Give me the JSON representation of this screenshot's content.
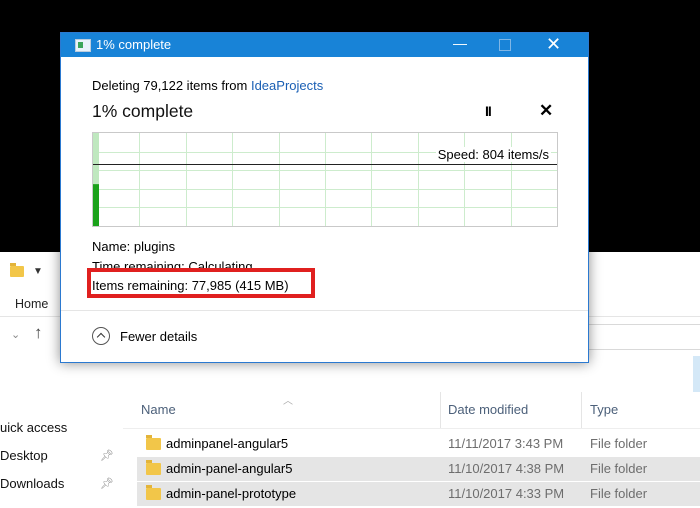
{
  "explorer": {
    "ribbon_home": "Home",
    "nav_pane": [
      {
        "label": "uick access",
        "pinned": false
      },
      {
        "label": "Desktop",
        "pinned": true
      },
      {
        "label": "Downloads",
        "pinned": true
      }
    ],
    "columns": {
      "name": "Name",
      "date": "Date modified",
      "type": "Type"
    },
    "rows": [
      {
        "name": "adminpanel-angular5",
        "date": "11/11/2017 3:43 PM",
        "type": "File folder",
        "selected": false
      },
      {
        "name": "admin-panel-angular5",
        "date": "11/10/2017 4:38 PM",
        "type": "File folder",
        "selected": true
      },
      {
        "name": "admin-panel-prototype",
        "date": "11/10/2017 4:33 PM",
        "type": "File folder",
        "selected": true
      }
    ]
  },
  "dialog": {
    "title": "1% complete",
    "deleting_prefix": "Deleting 79,122 items from ",
    "deleting_source": "IdeaProjects",
    "percent_heading": "1% complete",
    "pause_glyph": "II",
    "cancel_glyph": "✕",
    "speed": "Speed: 804 items/s",
    "progress_fraction": 0.01,
    "name_label": "Name:  plugins",
    "time_label": "Time remaining:  Calculating...",
    "items_label": "Items remaining:  77,985 (415 MB)",
    "fewer_details": "Fewer details"
  },
  "colors": {
    "titlebar": "#1883d7",
    "graph_fill": "#1aa21a",
    "grid": "#cdeccd",
    "highlight": "#e0201f",
    "link": "#1a5fb4"
  }
}
